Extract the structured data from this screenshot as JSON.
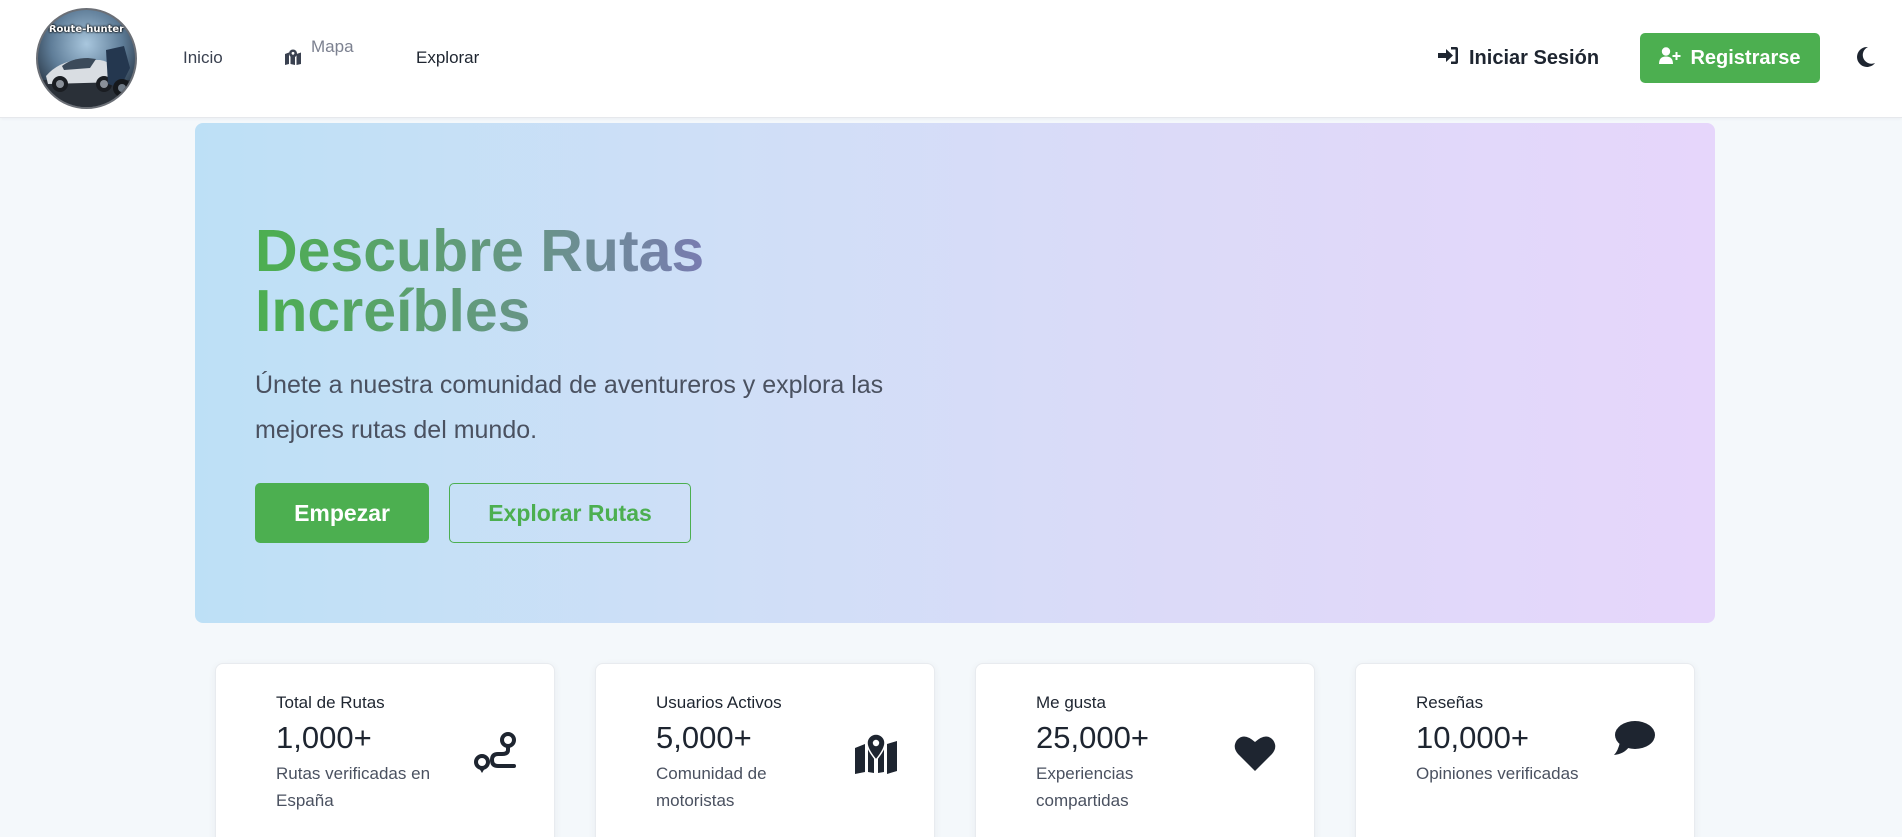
{
  "header": {
    "logo_text": "Route-hunter",
    "nav": [
      {
        "label": "Inicio"
      },
      {
        "label": "Mapa",
        "icon": "map-location-icon"
      },
      {
        "label": "Explorar"
      }
    ],
    "login_label": "Iniciar Sesión",
    "login_icon": "sign-in-icon",
    "register_label": "Registrarse",
    "register_icon": "user-plus-icon",
    "theme_icon": "moon-icon"
  },
  "hero": {
    "title": "Descubre Rutas Increíbles",
    "subtitle": "Únete a nuestra comunidad de aventureros y explora las mejores rutas del mundo.",
    "primary_button": "Empezar",
    "secondary_button": "Explorar Rutas"
  },
  "stats": [
    {
      "label": "Total de Rutas",
      "value": "1,000+",
      "desc": "Rutas verificadas en España",
      "icon": "route-icon"
    },
    {
      "label": "Usuarios Activos",
      "value": "5,000+",
      "desc": "Comunidad de motoristas",
      "icon": "map-location-icon"
    },
    {
      "label": "Me gusta",
      "value": "25,000+",
      "desc": "Experiencias compartidas",
      "icon": "heart-icon"
    },
    {
      "label": "Reseñas",
      "value": "10,000+",
      "desc": "Opiniones verificadas",
      "icon": "comment-icon"
    }
  ],
  "colors": {
    "accent": "#4caf50",
    "text": "#1e2530",
    "muted": "#4a5160",
    "hero_gradient_start": "#bde0f6",
    "hero_gradient_end": "#e6d6fb"
  }
}
